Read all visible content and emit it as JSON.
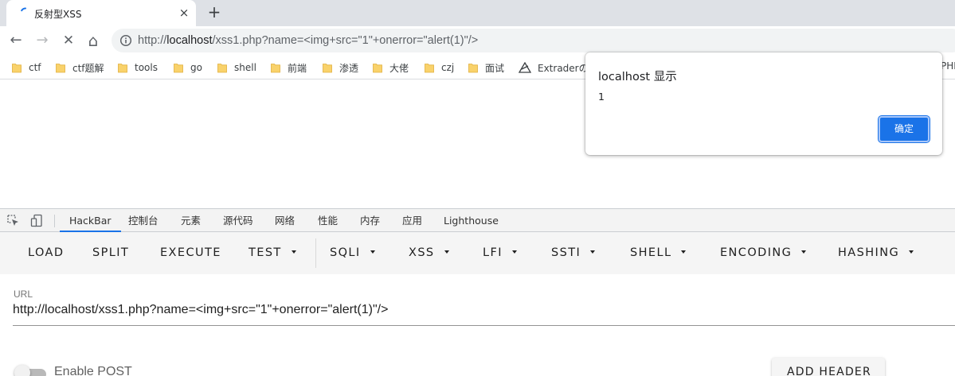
{
  "browser": {
    "tab": {
      "title": "反射型XSS",
      "close_icon": "×"
    },
    "new_tab_icon": "+",
    "nav": {
      "back_icon": "←",
      "forward_icon": "→",
      "stop_icon": "✕",
      "home_icon": "⌂"
    },
    "omnibox": {
      "scheme": "http://",
      "host": "localhost",
      "path": "/xss1.php?name=<img+src=\"1\"+onerror=\"alert(1)\"/>"
    },
    "bookmarks": [
      {
        "label": "ctf",
        "icon": "folder-icon"
      },
      {
        "label": "ctf题解",
        "icon": "folder-icon"
      },
      {
        "label": "tools",
        "icon": "folder-icon"
      },
      {
        "label": "go",
        "icon": "folder-icon"
      },
      {
        "label": "shell",
        "icon": "folder-icon"
      },
      {
        "label": "前端",
        "icon": "folder-icon"
      },
      {
        "label": "渗透",
        "icon": "folder-icon"
      },
      {
        "label": "大佬",
        "icon": "folder-icon"
      },
      {
        "label": "czj",
        "icon": "folder-icon"
      },
      {
        "label": "面试",
        "icon": "folder-icon"
      },
      {
        "label": "Extraderの",
        "icon": "extrader-icon"
      }
    ],
    "bookmarks_overflow": "PHI"
  },
  "dialog": {
    "title": "localhost 显示",
    "message": "1",
    "ok_label": "确定"
  },
  "devtools": {
    "tabs": [
      "HackBar",
      "控制台",
      "元素",
      "源代码",
      "网络",
      "性能",
      "内存",
      "应用",
      "Lighthouse"
    ],
    "active_tab": "HackBar"
  },
  "hackbar": {
    "menu": [
      {
        "label": "LOAD",
        "dropdown": false
      },
      {
        "label": "SPLIT",
        "dropdown": false
      },
      {
        "label": "EXECUTE",
        "dropdown": false
      },
      {
        "label": "TEST",
        "dropdown": true
      },
      {
        "label": "SQLI",
        "dropdown": true
      },
      {
        "label": "XSS",
        "dropdown": true
      },
      {
        "label": "LFI",
        "dropdown": true
      },
      {
        "label": "SSTI",
        "dropdown": true
      },
      {
        "label": "SHELL",
        "dropdown": true
      },
      {
        "label": "ENCODING",
        "dropdown": true
      },
      {
        "label": "HASHING",
        "dropdown": true
      }
    ],
    "url_label": "URL",
    "url_value": "http://localhost/xss1.php?name=<img+src=\"1\"+onerror=\"alert(1)\"/>",
    "enable_post_label": "Enable POST",
    "add_header_label": "ADD HEADER"
  },
  "colors": {
    "accent": "#1a73e8",
    "folder": "#f9d26b",
    "tabstrip": "#dee1e6"
  }
}
